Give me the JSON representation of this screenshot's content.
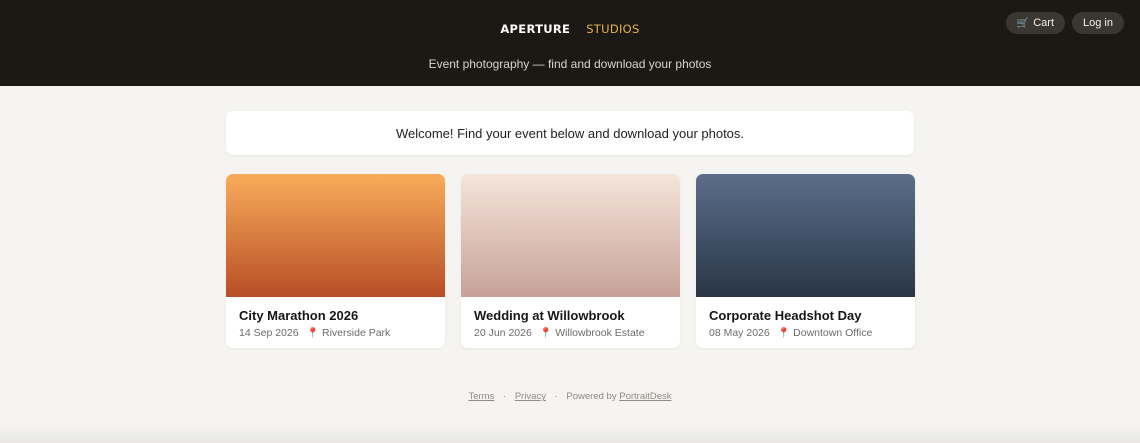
{
  "header": {
    "brand_main": "APERTURE",
    "brand_sub": "STUDIOS",
    "tagline": "Event photography — find and download your photos",
    "cart_label": "Cart",
    "login_label": "Log in",
    "cart_icon": "cart-icon"
  },
  "welcome": {
    "message": "Welcome! Find your event below and download your photos."
  },
  "events": [
    {
      "title": "City Marathon 2026",
      "date": "14 Sep 2026",
      "location": "Riverside Park"
    },
    {
      "title": "Wedding at Willowbrook",
      "date": "20 Jun 2026",
      "location": "Willowbrook Estate"
    },
    {
      "title": "Corporate Headshot Day",
      "date": "08 May 2026",
      "location": "Downtown Office"
    }
  ],
  "footer": {
    "terms": "Terms",
    "privacy": "Privacy",
    "powered_by": "Powered by",
    "powered_link": "PortraitDesk",
    "separator": "·"
  },
  "colors": {
    "header_bg": "#1c1914",
    "accent": "#e5b24d",
    "page_bg": "#f5f4f0",
    "pin": "#e0412f"
  }
}
